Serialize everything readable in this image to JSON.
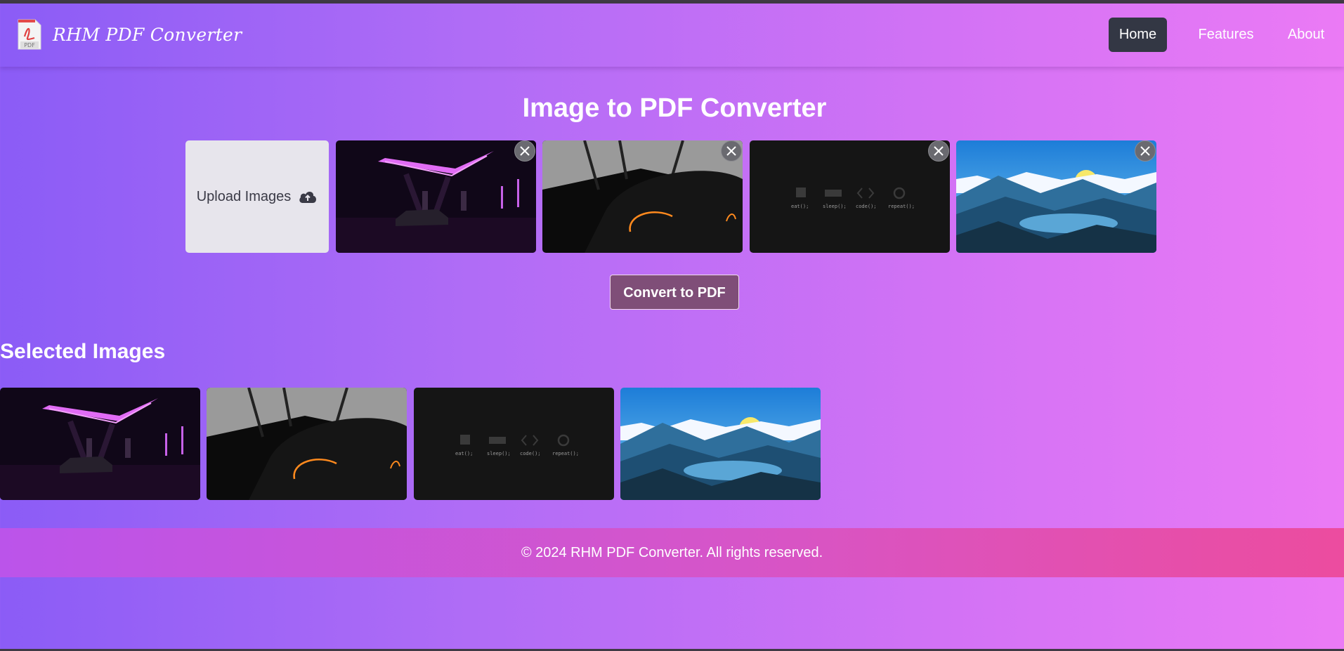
{
  "app": {
    "brand": "RHM PDF Converter",
    "logo_label": "PDF"
  },
  "nav": {
    "home": "Home",
    "features": "Features",
    "about": "About"
  },
  "main": {
    "title": "Image to PDF Converter",
    "upload_label": "Upload Images",
    "convert_label": "Convert to PDF",
    "selected_title": "Selected Images"
  },
  "thumbnail_text": {
    "eat": "eat();",
    "sleep": "sleep();",
    "code": "code();",
    "repeat": "repeat();"
  },
  "footer": {
    "text": "© 2024 RHM PDF Converter. All rights reserved."
  },
  "colors": {
    "nav_active": "#333744",
    "convert_button": "#7f4e78",
    "footer": "#d655c8"
  }
}
